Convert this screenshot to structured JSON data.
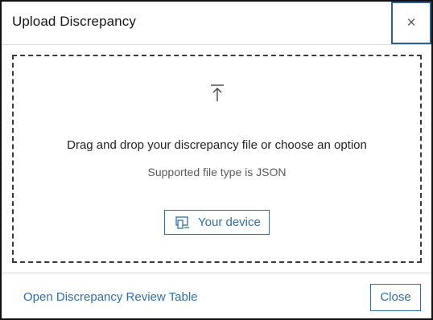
{
  "dialog": {
    "title": "Upload Discrepancy",
    "close_icon": "close-icon",
    "close_glyph": "×"
  },
  "dropzone": {
    "upload_icon": "upload-arrow-icon",
    "instruction": "Drag and drop your discrepancy file or choose an option",
    "supported_types": "Supported file type is JSON",
    "device_button": {
      "icon": "device-icon",
      "label": "Your device"
    }
  },
  "footer": {
    "review_link": "Open Discrepancy Review Table",
    "close_button": "Close"
  },
  "colors": {
    "accent": "#2f6fa8",
    "focus_ring": "#2f5e8f",
    "border_dark": "#111111",
    "divider": "#dcdcdc",
    "text_primary": "#222222",
    "text_secondary": "#5a5a5a"
  }
}
